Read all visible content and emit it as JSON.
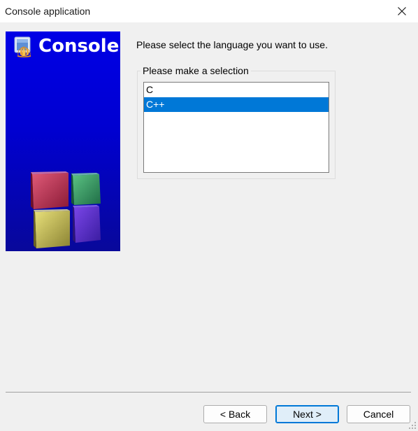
{
  "window": {
    "title": "Console application",
    "close_glyph": "✕"
  },
  "banner": {
    "title": "Console",
    "icon": "wizard-shell-icon",
    "image": "colored-cubes-logo",
    "colors": {
      "gradient_top": "#0000e6",
      "gradient_bottom": "#08089a",
      "text": "#ffffff"
    }
  },
  "main": {
    "prompt": "Please select the language you want to use.",
    "group_label": "Please make a selection",
    "languages": [
      "C",
      "C++"
    ],
    "selected_language": "C++"
  },
  "buttons": {
    "back": "< Back",
    "next": "Next >",
    "cancel": "Cancel"
  },
  "colors": {
    "selection": "#0078d7",
    "background": "#f0f0f0"
  }
}
